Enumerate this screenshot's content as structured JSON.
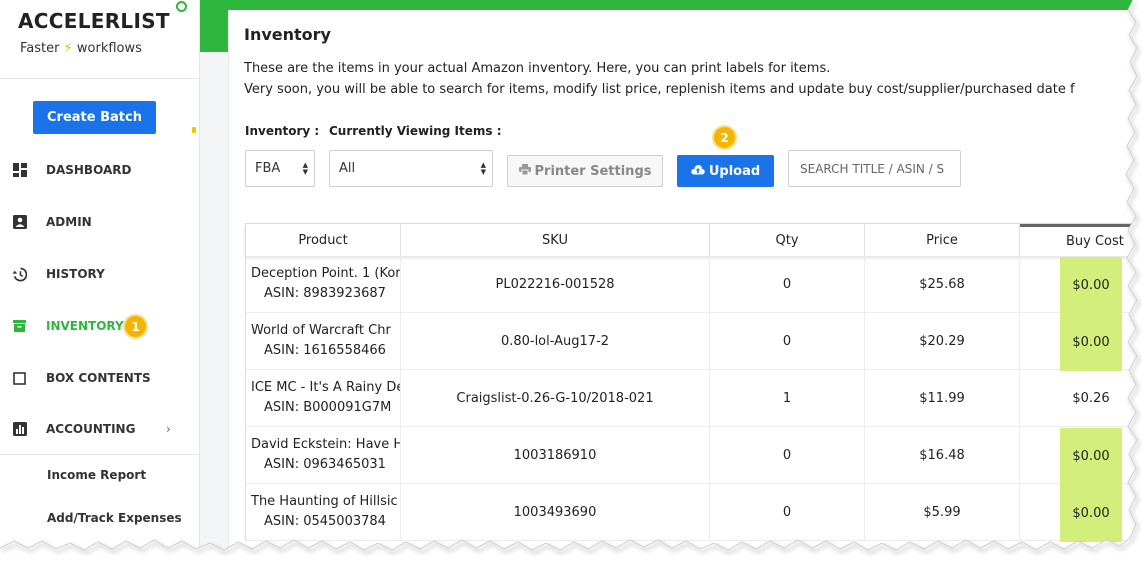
{
  "sidebar": {
    "brand": "ACCELERLIST",
    "tagline_prefix": "Faster",
    "tagline_suffix": "workflows",
    "create_batch": "Create Batch",
    "nav": [
      {
        "label": "DASHBOARD",
        "icon": "dashboard-icon"
      },
      {
        "label": "ADMIN",
        "icon": "admin-icon"
      },
      {
        "label": "HISTORY",
        "icon": "history-icon"
      },
      {
        "label": "INVENTORY",
        "icon": "inventory-icon",
        "active": true,
        "badge": "1"
      },
      {
        "label": "BOX CONTENTS",
        "icon": "box-icon"
      },
      {
        "label": "ACCOUNTING",
        "icon": "chart-icon",
        "chevron": "›"
      }
    ],
    "sub_items": [
      "Income Report",
      "Add/Track Expenses"
    ]
  },
  "page": {
    "title": "Inventory",
    "desc_line1": "These are the items in your actual Amazon inventory. Here, you can print labels for items.",
    "desc_line2": "Very soon, you will be able to search for items, modify list price, replenish items and update buy cost/supplier/purchased date f"
  },
  "filters": {
    "inventory_label": "Inventory :",
    "inventory_value": "FBA",
    "viewing_label": "Currently Viewing Items :",
    "viewing_value": "All",
    "printer_settings": "Printer Settings",
    "upload": "Upload",
    "upload_badge": "2",
    "search_placeholder": "SEARCH TITLE / ASIN / S"
  },
  "table": {
    "headers": [
      "Product",
      "SKU",
      "Qty",
      "Price",
      "Buy Cost"
    ],
    "rows": [
      {
        "title": "Deception Point. 1 (Kor",
        "asin": "ASIN: 8983923687",
        "sku": "PL022216-001528",
        "qty": "0",
        "price": "$25.68",
        "cost": "$0.00",
        "highlight": true
      },
      {
        "title": "World of Warcraft Chr",
        "asin": "ASIN: 1616558466",
        "sku": "0.80-lol-Aug17-2",
        "qty": "0",
        "price": "$20.29",
        "cost": "$0.00",
        "highlight": true
      },
      {
        "title": "ICE MC - It's A Rainy De",
        "asin": "ASIN: B000091G7M",
        "sku": "Craigslist-0.26-G-10/2018-021",
        "qty": "1",
        "price": "$11.99",
        "cost": "$0.26",
        "highlight": false
      },
      {
        "title": "David Eckstein: Have H",
        "asin": "ASIN: 0963465031",
        "sku": "1003186910",
        "qty": "0",
        "price": "$16.48",
        "cost": "$0.00",
        "highlight": true
      },
      {
        "title": "The Haunting of Hillsic",
        "asin": "ASIN: 0545003784",
        "sku": "1003493690",
        "qty": "0",
        "price": "$5.99",
        "cost": "$0.00",
        "highlight": true
      }
    ]
  },
  "colors": {
    "accent_green": "#2db83d",
    "primary_blue": "#1a73e8",
    "badge_yellow": "#f5b400",
    "cost_highlight": "#d4ee7c"
  }
}
